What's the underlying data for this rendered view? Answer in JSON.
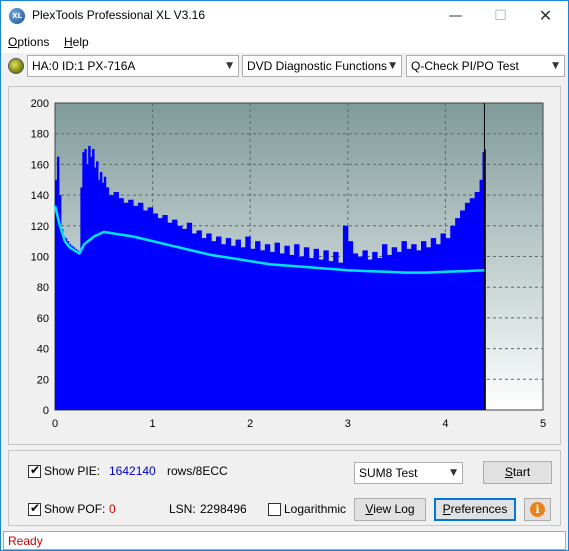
{
  "window": {
    "title": "PlexTools Professional XL V3.16",
    "app_icon_label": "XL",
    "minimize_glyph": "—",
    "maximize_glyph": "☐",
    "close_glyph": "✕"
  },
  "menu": {
    "options": {
      "underlined": "O",
      "rest": "ptions"
    },
    "help": {
      "underlined": "H",
      "rest": "elp"
    }
  },
  "toolbar": {
    "drive": "HA:0 ID:1  PX-716A",
    "function": "DVD Diagnostic Functions",
    "test": "Q-Check PI/PO Test",
    "arrow": "▼"
  },
  "chart_data": {
    "type": "bar",
    "y_ticks": [
      "0",
      "20",
      "40",
      "60",
      "80",
      "100",
      "120",
      "140",
      "160",
      "180",
      "200"
    ],
    "x_ticks": [
      "0",
      "1",
      "2",
      "3",
      "4",
      "5"
    ],
    "xlim": [
      0,
      5
    ],
    "ylim": [
      0,
      200
    ],
    "grid": true,
    "data_end_x": 4.4,
    "series": [
      {
        "kind": "bars",
        "color": "#0000ff",
        "points": [
          [
            0.0,
            150
          ],
          [
            0.02,
            165
          ],
          [
            0.04,
            140
          ],
          [
            0.06,
            118
          ],
          [
            0.08,
            113
          ],
          [
            0.1,
            112
          ],
          [
            0.12,
            110
          ],
          [
            0.14,
            108
          ],
          [
            0.16,
            107
          ],
          [
            0.18,
            106
          ],
          [
            0.2,
            105
          ],
          [
            0.22,
            104
          ],
          [
            0.24,
            103
          ],
          [
            0.26,
            145
          ],
          [
            0.28,
            168
          ],
          [
            0.3,
            170
          ],
          [
            0.32,
            160
          ],
          [
            0.34,
            172
          ],
          [
            0.36,
            165
          ],
          [
            0.38,
            170
          ],
          [
            0.4,
            158
          ],
          [
            0.42,
            162
          ],
          [
            0.44,
            150
          ],
          [
            0.46,
            155
          ],
          [
            0.48,
            148
          ],
          [
            0.5,
            152
          ],
          [
            0.52,
            145
          ],
          [
            0.55,
            140
          ],
          [
            0.6,
            142
          ],
          [
            0.65,
            138
          ],
          [
            0.7,
            135
          ],
          [
            0.75,
            137
          ],
          [
            0.8,
            133
          ],
          [
            0.85,
            135
          ],
          [
            0.9,
            130
          ],
          [
            0.95,
            132
          ],
          [
            1.0,
            128
          ],
          [
            1.05,
            125
          ],
          [
            1.1,
            127
          ],
          [
            1.15,
            122
          ],
          [
            1.2,
            124
          ],
          [
            1.25,
            120
          ],
          [
            1.3,
            118
          ],
          [
            1.35,
            122
          ],
          [
            1.4,
            115
          ],
          [
            1.45,
            117
          ],
          [
            1.5,
            112
          ],
          [
            1.55,
            115
          ],
          [
            1.6,
            110
          ],
          [
            1.65,
            113
          ],
          [
            1.7,
            108
          ],
          [
            1.75,
            112
          ],
          [
            1.8,
            107
          ],
          [
            1.85,
            111
          ],
          [
            1.9,
            106
          ],
          [
            1.95,
            113
          ],
          [
            2.0,
            105
          ],
          [
            2.05,
            110
          ],
          [
            2.1,
            104
          ],
          [
            2.15,
            108
          ],
          [
            2.2,
            103
          ],
          [
            2.25,
            109
          ],
          [
            2.3,
            102
          ],
          [
            2.35,
            107
          ],
          [
            2.4,
            101
          ],
          [
            2.45,
            108
          ],
          [
            2.5,
            100
          ],
          [
            2.55,
            106
          ],
          [
            2.6,
            99
          ],
          [
            2.65,
            105
          ],
          [
            2.7,
            98
          ],
          [
            2.75,
            104
          ],
          [
            2.8,
            97
          ],
          [
            2.85,
            103
          ],
          [
            2.9,
            96
          ],
          [
            2.95,
            120
          ],
          [
            3.0,
            110
          ],
          [
            3.05,
            102
          ],
          [
            3.1,
            100
          ],
          [
            3.15,
            104
          ],
          [
            3.2,
            98
          ],
          [
            3.25,
            103
          ],
          [
            3.3,
            99
          ],
          [
            3.35,
            108
          ],
          [
            3.4,
            101
          ],
          [
            3.45,
            106
          ],
          [
            3.5,
            103
          ],
          [
            3.55,
            110
          ],
          [
            3.6,
            105
          ],
          [
            3.65,
            108
          ],
          [
            3.7,
            104
          ],
          [
            3.75,
            110
          ],
          [
            3.8,
            106
          ],
          [
            3.85,
            112
          ],
          [
            3.9,
            108
          ],
          [
            3.95,
            115
          ],
          [
            4.0,
            112
          ],
          [
            4.05,
            120
          ],
          [
            4.1,
            125
          ],
          [
            4.15,
            130
          ],
          [
            4.2,
            135
          ],
          [
            4.25,
            138
          ],
          [
            4.3,
            142
          ],
          [
            4.35,
            150
          ],
          [
            4.38,
            168
          ],
          [
            4.4,
            170
          ]
        ]
      },
      {
        "kind": "line",
        "color": "#00e5ff",
        "points": [
          [
            0.0,
            133
          ],
          [
            0.05,
            120
          ],
          [
            0.1,
            110
          ],
          [
            0.15,
            106
          ],
          [
            0.2,
            104
          ],
          [
            0.25,
            102
          ],
          [
            0.3,
            108
          ],
          [
            0.4,
            113
          ],
          [
            0.5,
            116
          ],
          [
            0.6,
            115
          ],
          [
            0.8,
            113
          ],
          [
            1.0,
            110
          ],
          [
            1.2,
            107
          ],
          [
            1.4,
            104
          ],
          [
            1.6,
            101
          ],
          [
            1.8,
            99
          ],
          [
            2.0,
            97
          ],
          [
            2.2,
            95
          ],
          [
            2.4,
            94
          ],
          [
            2.6,
            93
          ],
          [
            2.8,
            92
          ],
          [
            3.0,
            91
          ],
          [
            3.2,
            90.5
          ],
          [
            3.4,
            90
          ],
          [
            3.6,
            89.5
          ],
          [
            3.8,
            89.5
          ],
          [
            4.0,
            90
          ],
          [
            4.2,
            90.5
          ],
          [
            4.4,
            91
          ]
        ]
      }
    ]
  },
  "controls": {
    "show_pie_label": "Show PIE:",
    "pie_value": "1642140",
    "pie_unit": "rows/8ECC",
    "show_pof_label": "Show POF:",
    "pof_value": "0",
    "lsn_label": "LSN:",
    "lsn_value": "2298496",
    "log_label": "Logarithmic",
    "sum_select": "SUM8 Test",
    "start": {
      "underlined": "S",
      "rest": "tart"
    },
    "view_log": {
      "underlined": "V",
      "rest": "iew Log"
    },
    "preferences": {
      "underlined": "P",
      "rest": "references"
    },
    "check_glyph": "✔",
    "info_glyph": "i",
    "arrow": "▼"
  },
  "status": {
    "text": "Ready"
  }
}
